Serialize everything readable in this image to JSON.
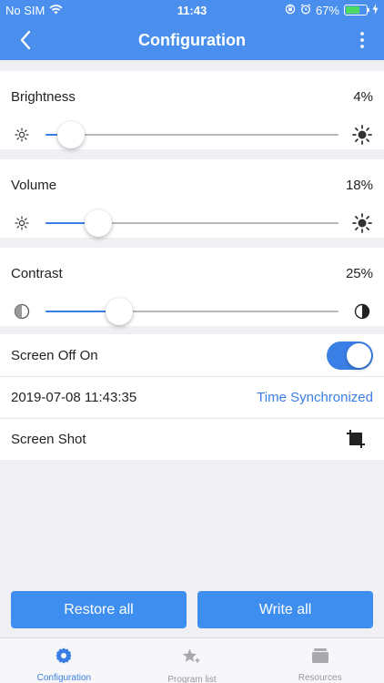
{
  "status_bar": {
    "carrier": "No SIM",
    "time": "11:43",
    "battery_percent": "67%",
    "battery_level": 0.67
  },
  "nav": {
    "title": "Configuration"
  },
  "sliders": [
    {
      "label": "Brightness",
      "value_text": "4%",
      "value": 0.04,
      "icon_low": "sun-small-icon",
      "icon_high": "sun-large-icon"
    },
    {
      "label": "Volume",
      "value_text": "18%",
      "value": 0.18,
      "icon_low": "sun-small-icon",
      "icon_high": "sun-large-icon"
    },
    {
      "label": "Contrast",
      "value_text": "25%",
      "value": 0.25,
      "icon_low": "contrast-icon",
      "icon_high": "contrast-icon"
    }
  ],
  "settings": {
    "screen_off_on": {
      "label": "Screen Off On",
      "enabled": true
    },
    "time_sync": {
      "datetime": "2019-07-08 11:43:35",
      "action": "Time Synchronized"
    },
    "screen_shot": {
      "label": "Screen Shot",
      "icon": "crop-icon"
    }
  },
  "buttons": {
    "restore_all": "Restore all",
    "write_all": "Write all"
  },
  "tabs": [
    {
      "label": "Configuration",
      "icon": "gear-icon",
      "active": true
    },
    {
      "label": "Program list",
      "icon": "star-list-icon",
      "active": false
    },
    {
      "label": "Resources",
      "icon": "stack-icon",
      "active": false
    }
  ],
  "colors": {
    "accent": "#4a8fee",
    "link": "#3a7fe6",
    "button": "#3e8ef0",
    "background": "#efeff4"
  }
}
